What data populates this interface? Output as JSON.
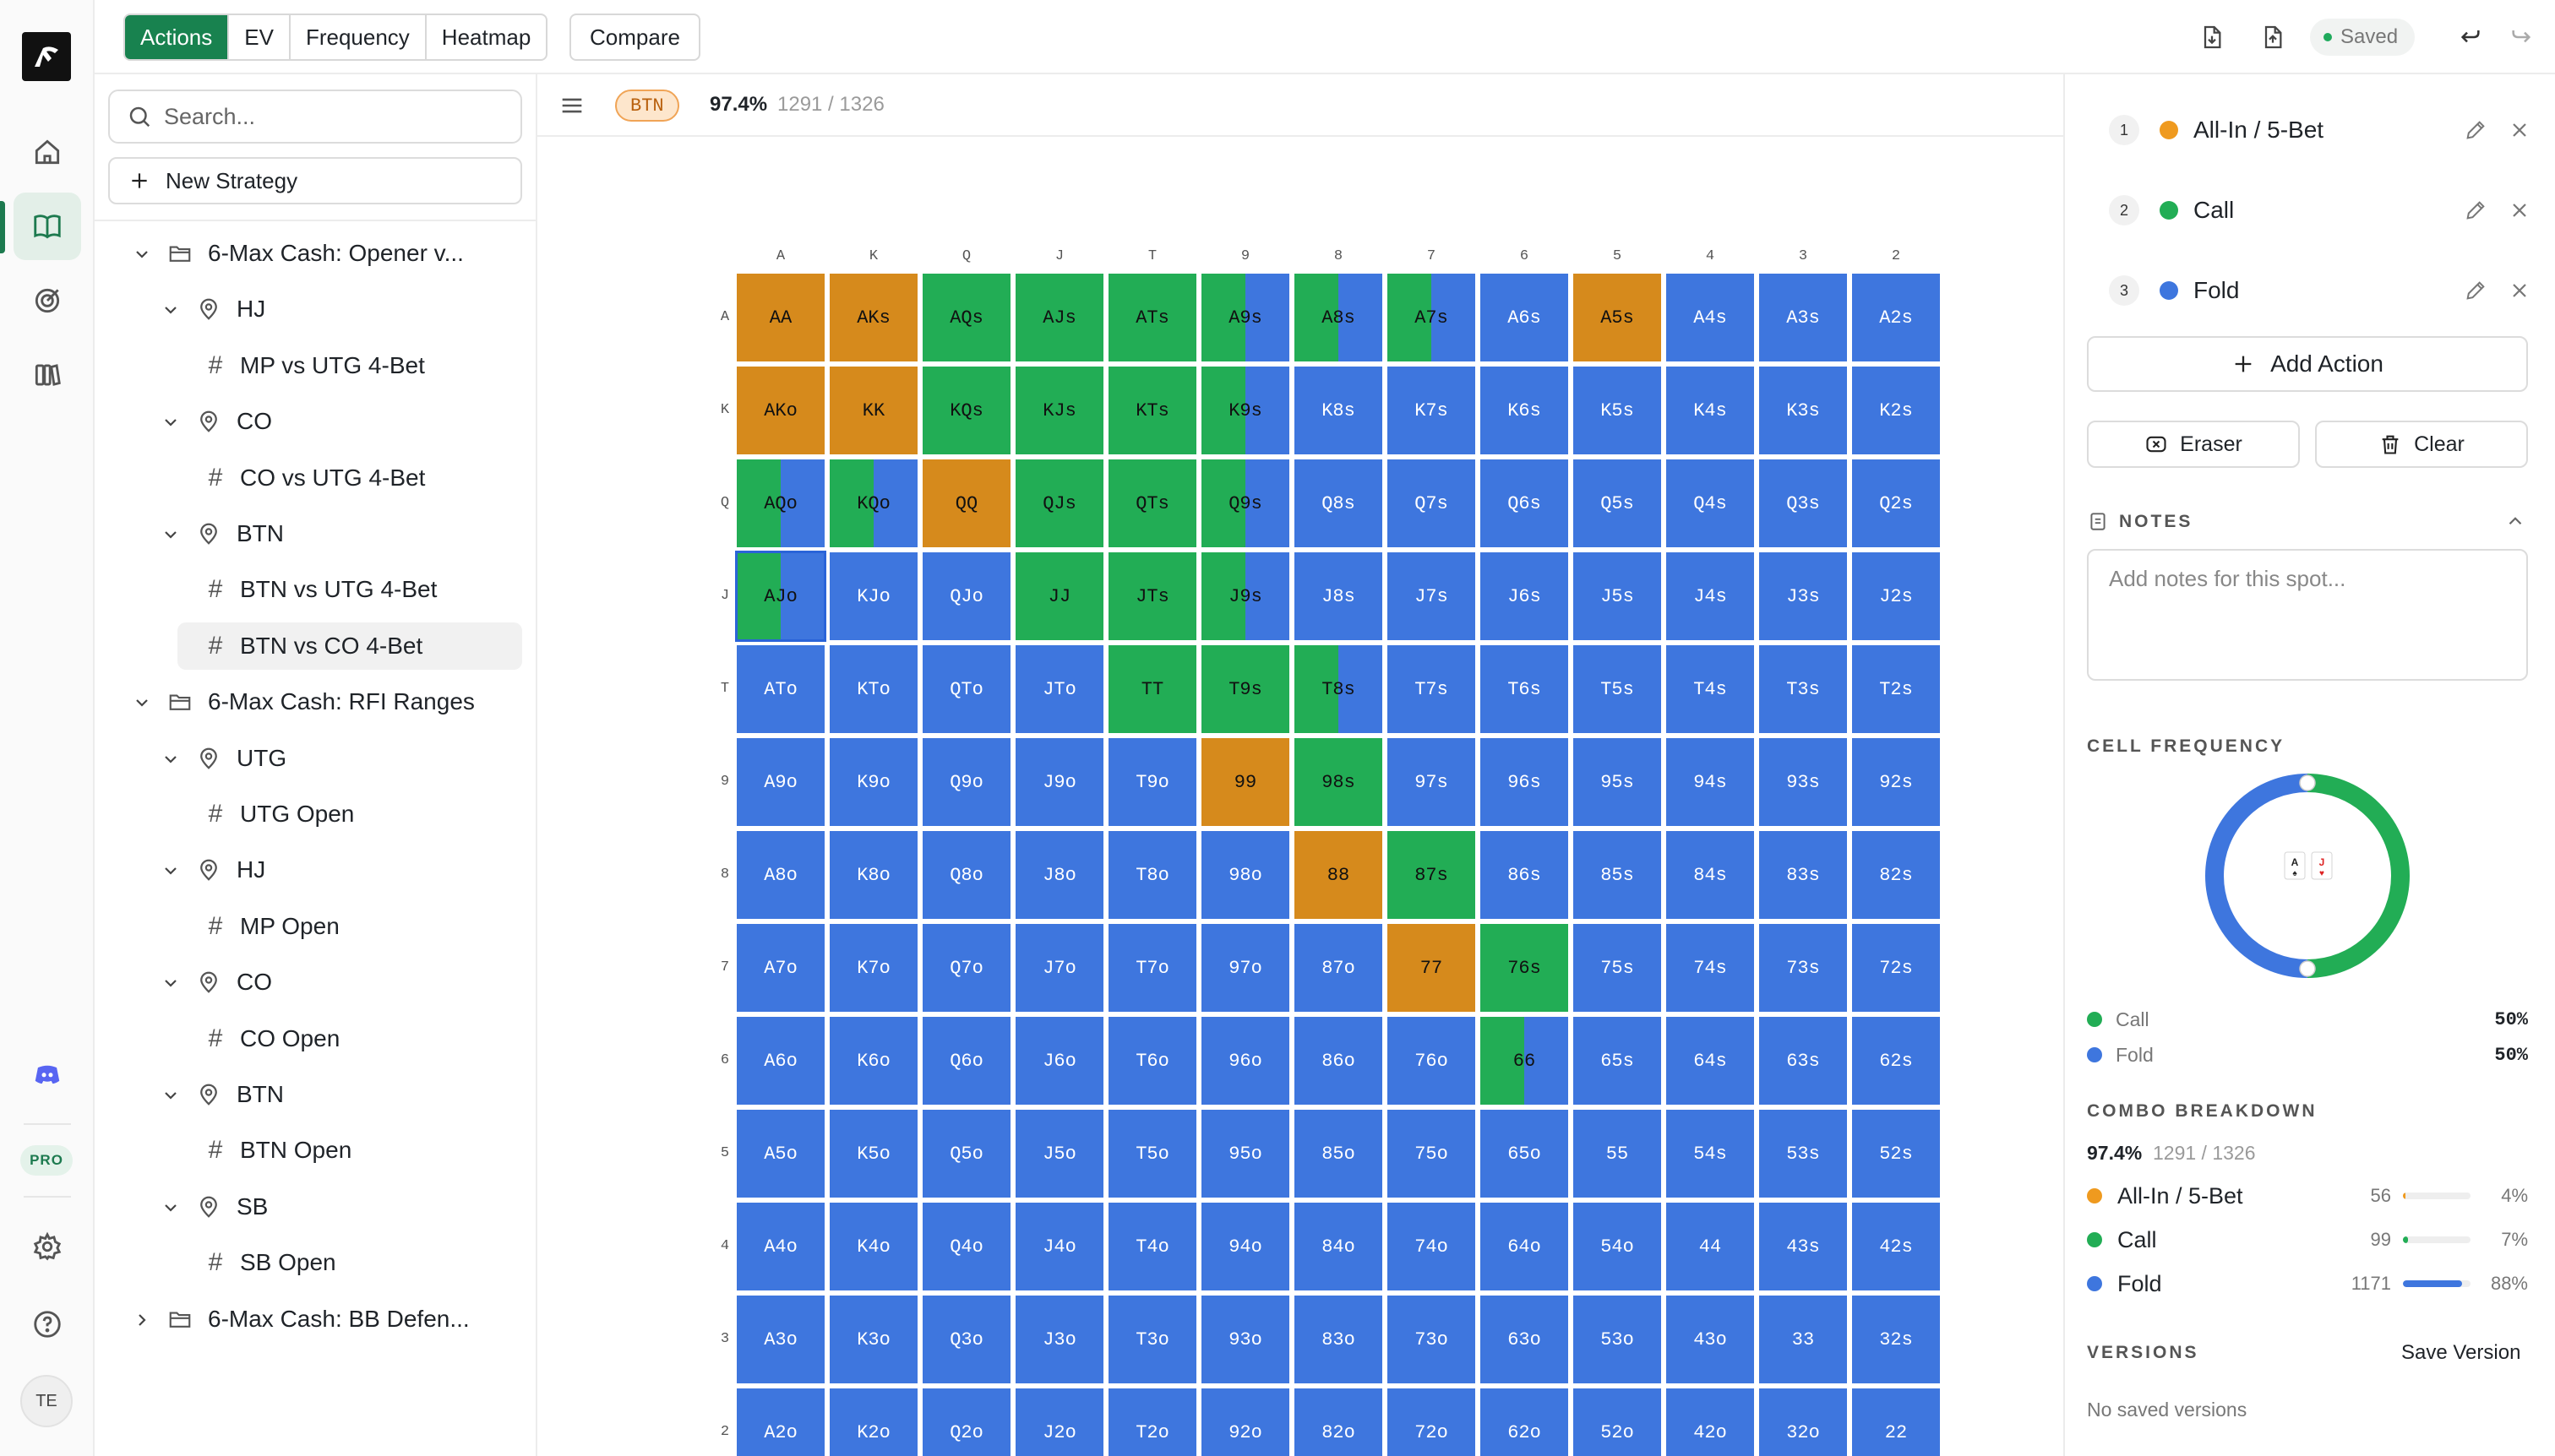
{
  "toolbar": {
    "tabs": [
      {
        "label": "Actions",
        "active": true
      },
      {
        "label": "EV",
        "active": false
      },
      {
        "label": "Frequency",
        "active": false
      },
      {
        "label": "Heatmap",
        "active": false
      }
    ],
    "compare_label": "Compare",
    "saved_label": "Saved"
  },
  "sidebar": {
    "search_placeholder": "Search...",
    "new_strategy_label": "New Strategy",
    "tree": [
      {
        "type": "folder",
        "label": "6-Max Cash: Opener v...",
        "expanded": true,
        "level": 0
      },
      {
        "type": "position",
        "label": "HJ",
        "expanded": true,
        "level": 1
      },
      {
        "type": "spot",
        "label": "MP vs UTG 4-Bet",
        "level": 2
      },
      {
        "type": "position",
        "label": "CO",
        "expanded": true,
        "level": 1
      },
      {
        "type": "spot",
        "label": "CO vs UTG 4-Bet",
        "level": 2
      },
      {
        "type": "position",
        "label": "BTN",
        "expanded": true,
        "level": 1
      },
      {
        "type": "spot",
        "label": "BTN vs UTG 4-Bet",
        "level": 2
      },
      {
        "type": "spot",
        "label": "BTN vs CO 4-Bet",
        "level": 2,
        "selected": true
      },
      {
        "type": "folder",
        "label": "6-Max Cash: RFI Ranges",
        "expanded": true,
        "level": 0
      },
      {
        "type": "position",
        "label": "UTG",
        "expanded": true,
        "level": 1
      },
      {
        "type": "spot",
        "label": "UTG Open",
        "level": 2
      },
      {
        "type": "position",
        "label": "HJ",
        "expanded": true,
        "level": 1
      },
      {
        "type": "spot",
        "label": "MP Open",
        "level": 2
      },
      {
        "type": "position",
        "label": "CO",
        "expanded": true,
        "level": 1
      },
      {
        "type": "spot",
        "label": "CO Open",
        "level": 2
      },
      {
        "type": "position",
        "label": "BTN",
        "expanded": true,
        "level": 1
      },
      {
        "type": "spot",
        "label": "BTN Open",
        "level": 2
      },
      {
        "type": "position",
        "label": "SB",
        "expanded": true,
        "level": 1
      },
      {
        "type": "spot",
        "label": "SB Open",
        "level": 2
      },
      {
        "type": "folder",
        "label": "6-Max Cash: BB Defen...",
        "expanded": false,
        "level": 0
      }
    ]
  },
  "main": {
    "position_badge": "BTN",
    "percent": "97.4%",
    "combos": "1291 / 1326",
    "ranks": [
      "A",
      "K",
      "Q",
      "J",
      "T",
      "9",
      "8",
      "7",
      "6",
      "5",
      "4",
      "3",
      "2"
    ],
    "colors": {
      "allin": "#d68a1c",
      "call": "#22ad55",
      "fold": "#3e76de"
    },
    "highlight_cell": [
      3,
      0
    ],
    "mixed_cells": [
      {
        "r": 0,
        "c": 5,
        "call": 0.5,
        "fold": 0.5
      },
      {
        "r": 0,
        "c": 6,
        "call": 0.5,
        "fold": 0.5
      },
      {
        "r": 0,
        "c": 7,
        "call": 0.5,
        "fold": 0.5
      },
      {
        "r": 1,
        "c": 5,
        "call": 0.5,
        "fold": 0.5
      },
      {
        "r": 2,
        "c": 0,
        "call": 0.5,
        "fold": 0.5
      },
      {
        "r": 2,
        "c": 1,
        "call": 0.5,
        "fold": 0.5
      },
      {
        "r": 2,
        "c": 5,
        "call": 0.5,
        "fold": 0.5
      },
      {
        "r": 3,
        "c": 0,
        "call": 0.5,
        "fold": 0.5
      },
      {
        "r": 3,
        "c": 5,
        "call": 0.5,
        "fold": 0.5
      },
      {
        "r": 4,
        "c": 6,
        "call": 0.5,
        "fold": 0.5
      },
      {
        "r": 8,
        "c": 8,
        "call": 0.5,
        "fold": 0.5
      }
    ],
    "allin_cells": [
      [
        0,
        0
      ],
      [
        0,
        1
      ],
      [
        0,
        9
      ],
      [
        1,
        0
      ],
      [
        1,
        1
      ],
      [
        2,
        2
      ],
      [
        5,
        5
      ],
      [
        6,
        6
      ],
      [
        7,
        7
      ]
    ],
    "call_cells": [
      [
        0,
        2
      ],
      [
        0,
        3
      ],
      [
        0,
        4
      ],
      [
        1,
        2
      ],
      [
        1,
        3
      ],
      [
        1,
        4
      ],
      [
        2,
        3
      ],
      [
        2,
        4
      ],
      [
        3,
        3
      ],
      [
        3,
        4
      ],
      [
        4,
        4
      ],
      [
        4,
        5
      ],
      [
        5,
        6
      ],
      [
        6,
        7
      ],
      [
        7,
        8
      ]
    ]
  },
  "actions": [
    {
      "num": "1",
      "label": "All-In / 5-Bet",
      "color": "#ef9a1f"
    },
    {
      "num": "2",
      "label": "Call",
      "color": "#22ad55"
    },
    {
      "num": "3",
      "label": "Fold",
      "color": "#3e76de"
    }
  ],
  "right": {
    "add_action_label": "Add Action",
    "eraser_label": "Eraser",
    "clear_label": "Clear",
    "notes_title": "NOTES",
    "notes_placeholder": "Add notes for this spot...",
    "cell_frequency_title": "CELL FREQUENCY",
    "cell_frequency": [
      {
        "label": "Call",
        "value": "50%",
        "fraction": 0.5,
        "color": "#22ad55"
      },
      {
        "label": "Fold",
        "value": "50%",
        "fraction": 0.5,
        "color": "#3e76de"
      }
    ],
    "card_ranks": [
      "A",
      "J"
    ],
    "combo_title": "COMBO BREAKDOWN",
    "combo_percent": "97.4%",
    "combo_total": "1291 / 1326",
    "combos": [
      {
        "label": "All-In / 5-Bet",
        "count": "56",
        "pct": "4%",
        "fraction": 0.04,
        "color": "#ef9a1f"
      },
      {
        "label": "Call",
        "count": "99",
        "pct": "7%",
        "fraction": 0.07,
        "color": "#22ad55"
      },
      {
        "label": "Fold",
        "count": "1171",
        "pct": "88%",
        "fraction": 0.88,
        "color": "#3e76de"
      }
    ],
    "versions_title": "VERSIONS",
    "save_version_label": "Save Version",
    "no_versions_label": "No saved versions"
  },
  "rail": {
    "pro_label": "PRO",
    "avatar_initials": "TE"
  }
}
